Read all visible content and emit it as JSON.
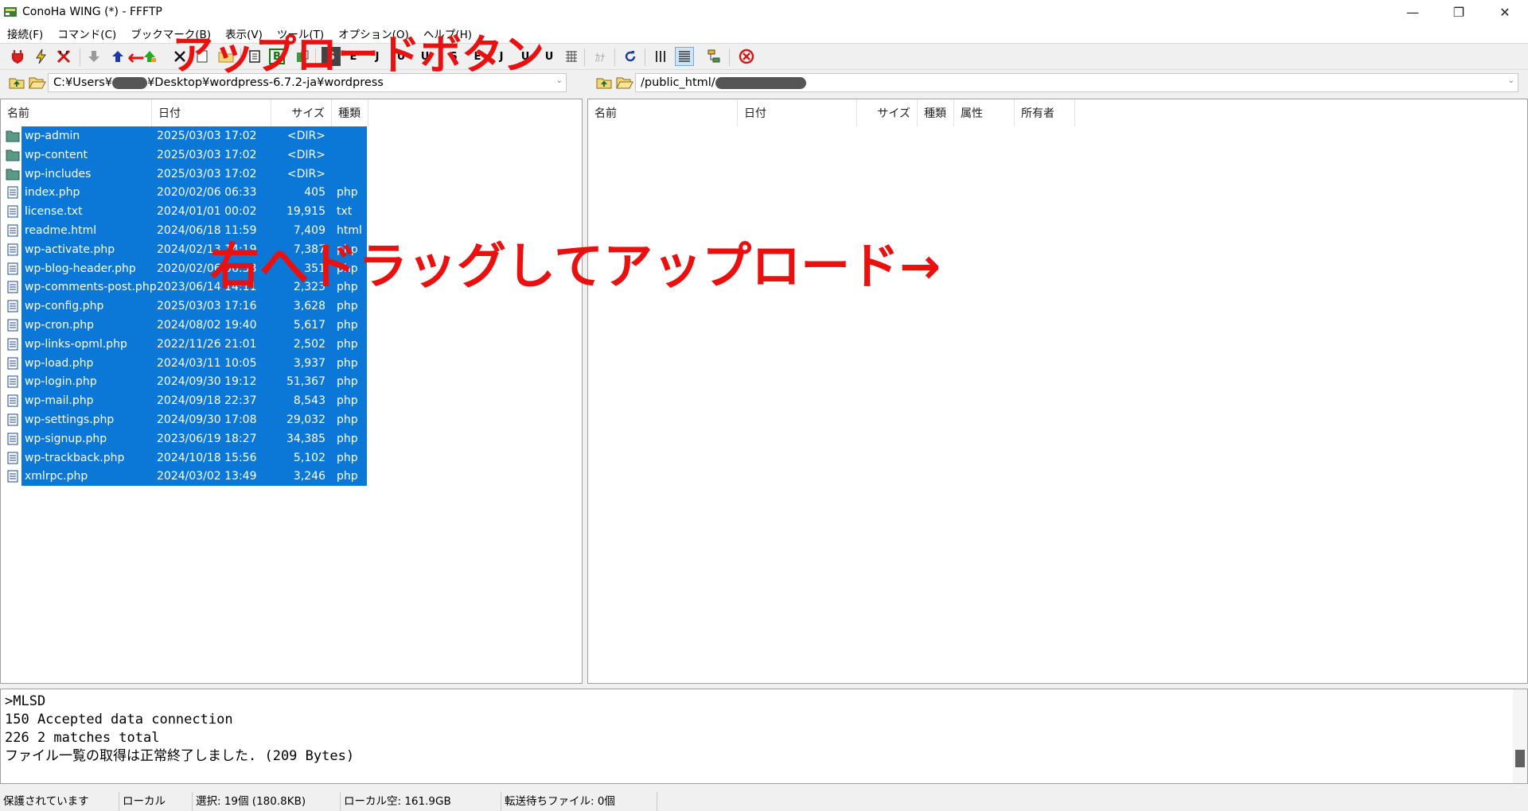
{
  "window": {
    "title": "ConoHa WING (*) - FFFTP",
    "controls": [
      "—",
      "❐",
      "✕"
    ]
  },
  "menu": [
    "接続(F)",
    "コマンド(C)",
    "ブックマーク(B)",
    "表示(V)",
    "ツール(T)",
    "オプション(O)",
    "ヘルプ(H)"
  ],
  "toolbar": {
    "buttons": [
      "connect",
      "quick-connect",
      "disconnect",
      "download",
      "upload",
      "mirror-upload",
      "delete",
      "rename",
      "mkdir",
      "list",
      "binary",
      "ascii",
      "sjis",
      "euc",
      "jis",
      "utf8",
      "utf8-bom",
      "sjis2",
      "euc2",
      "jis2",
      "utf8-2",
      "utf8-bom2",
      "kana",
      "refresh",
      "list-view",
      "detail-view",
      "tree-view",
      "stop"
    ],
    "labels": {
      "sjis": "S",
      "euc": "E",
      "jis": "J",
      "utf8": "U",
      "utf8-bom": "U",
      "kana": "ｶﾅ",
      "binary": "B",
      "ascii": "A"
    }
  },
  "local": {
    "path_prefix": "C:¥Users¥",
    "path_suffix": "¥Desktop¥wordpress-6.7.2-ja¥wordpress",
    "columns": [
      "名前",
      "日付",
      "サイズ",
      "種類"
    ],
    "files": [
      {
        "name": "wp-admin",
        "date": "2025/03/03 17:02",
        "size": "<DIR>",
        "type": "",
        "dir": true
      },
      {
        "name": "wp-content",
        "date": "2025/03/03 17:02",
        "size": "<DIR>",
        "type": "",
        "dir": true
      },
      {
        "name": "wp-includes",
        "date": "2025/03/03 17:02",
        "size": "<DIR>",
        "type": "",
        "dir": true
      },
      {
        "name": "index.php",
        "date": "2020/02/06 06:33",
        "size": "405",
        "type": "php",
        "dir": false
      },
      {
        "name": "license.txt",
        "date": "2024/01/01 00:02",
        "size": "19,915",
        "type": "txt",
        "dir": false
      },
      {
        "name": "readme.html",
        "date": "2024/06/18 11:59",
        "size": "7,409",
        "type": "html",
        "dir": false
      },
      {
        "name": "wp-activate.php",
        "date": "2024/02/13 14:19",
        "size": "7,387",
        "type": "php",
        "dir": false
      },
      {
        "name": "wp-blog-header.php",
        "date": "2020/02/06 06:33",
        "size": "351",
        "type": "php",
        "dir": false
      },
      {
        "name": "wp-comments-post.php",
        "date": "2023/06/14 14:11",
        "size": "2,323",
        "type": "php",
        "dir": false
      },
      {
        "name": "wp-config.php",
        "date": "2025/03/03 17:16",
        "size": "3,628",
        "type": "php",
        "dir": false
      },
      {
        "name": "wp-cron.php",
        "date": "2024/08/02 19:40",
        "size": "5,617",
        "type": "php",
        "dir": false
      },
      {
        "name": "wp-links-opml.php",
        "date": "2022/11/26 21:01",
        "size": "2,502",
        "type": "php",
        "dir": false
      },
      {
        "name": "wp-load.php",
        "date": "2024/03/11 10:05",
        "size": "3,937",
        "type": "php",
        "dir": false
      },
      {
        "name": "wp-login.php",
        "date": "2024/09/30 19:12",
        "size": "51,367",
        "type": "php",
        "dir": false
      },
      {
        "name": "wp-mail.php",
        "date": "2024/09/18 22:37",
        "size": "8,543",
        "type": "php",
        "dir": false
      },
      {
        "name": "wp-settings.php",
        "date": "2024/09/30 17:08",
        "size": "29,032",
        "type": "php",
        "dir": false
      },
      {
        "name": "wp-signup.php",
        "date": "2023/06/19 18:27",
        "size": "34,385",
        "type": "php",
        "dir": false
      },
      {
        "name": "wp-trackback.php",
        "date": "2024/10/18 15:56",
        "size": "5,102",
        "type": "php",
        "dir": false
      },
      {
        "name": "xmlrpc.php",
        "date": "2024/03/02 13:49",
        "size": "3,246",
        "type": "php",
        "dir": false
      }
    ]
  },
  "remote": {
    "path_prefix": "/public_html/",
    "columns": [
      "名前",
      "日付",
      "サイズ",
      "種類",
      "属性",
      "所有者"
    ]
  },
  "log": {
    "lines": [
      ">MLSD",
      "150 Accepted data connection",
      "226 2 matches total",
      "ファイル一覧の取得は正常終了しました. (209 Bytes)"
    ]
  },
  "status": {
    "cells": [
      "保護されています",
      "ローカル",
      "選択: 19個 (180.8KB)",
      "ローカル空: 161.9GB",
      "転送待ちファイル: 0個",
      ""
    ]
  },
  "annotations": {
    "upload_button": "アップロードボタン",
    "drag_hint": "右へドラッグしてアップロード→",
    "arrow": "←"
  },
  "colors": {
    "selection": "#0b78d7",
    "annotation": "#ea1010"
  }
}
